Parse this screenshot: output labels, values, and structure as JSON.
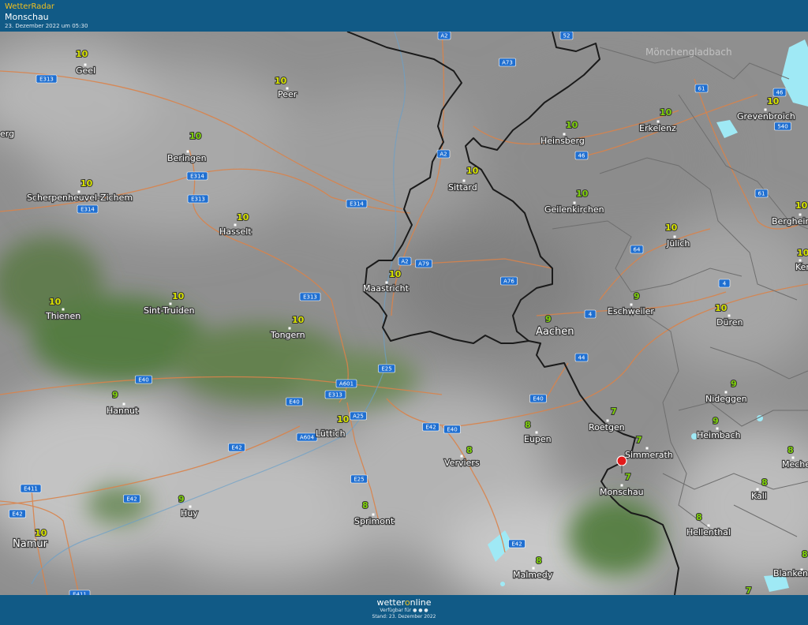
{
  "header": {
    "brand": "WetterRadar",
    "location": "Monschau",
    "timestamp": "23. Dezember 2022 um 05:30"
  },
  "places": [
    {
      "name": "Geel",
      "temp": "10"
    },
    {
      "name": "Peer",
      "temp": "10"
    },
    {
      "name": "Beringen",
      "temp": "10"
    },
    {
      "name": "Scherpenheuvel-Zichem",
      "temp": "10"
    },
    {
      "name": "Hasselt",
      "temp": "10"
    },
    {
      "name": "Thienen",
      "temp": "10"
    },
    {
      "name": "Sint-Truiden",
      "temp": "10"
    },
    {
      "name": "Tongern",
      "temp": "10"
    },
    {
      "name": "Hannut",
      "temp": "9"
    },
    {
      "name": "Lüttich",
      "temp": "10"
    },
    {
      "name": "Huy",
      "temp": "9"
    },
    {
      "name": "Namur",
      "temp": "10"
    },
    {
      "name": "Maastricht",
      "temp": "10"
    },
    {
      "name": "Sittard",
      "temp": "10"
    },
    {
      "name": "Heinsberg",
      "temp": "10"
    },
    {
      "name": "Erkelenz",
      "temp": "10"
    },
    {
      "name": "Grevenbroich",
      "temp": "10"
    },
    {
      "name": "Geilenkirchen",
      "temp": "10"
    },
    {
      "name": "Jülich",
      "temp": "10"
    },
    {
      "name": "Bergheim",
      "temp": "10"
    },
    {
      "name": "Ker",
      "temp": "10"
    },
    {
      "name": "Eschweiler",
      "temp": "9"
    },
    {
      "name": "Düren",
      "temp": "10"
    },
    {
      "name": "Aachen",
      "temp": "9"
    },
    {
      "name": "Nideggen",
      "temp": "9"
    },
    {
      "name": "Heimbach",
      "temp": "9"
    },
    {
      "name": "Roetgen",
      "temp": "7"
    },
    {
      "name": "Simmerath",
      "temp": "7"
    },
    {
      "name": "Monschau",
      "temp": "7"
    },
    {
      "name": "Eupen",
      "temp": "8"
    },
    {
      "name": "Verviers",
      "temp": "8"
    },
    {
      "name": "Sprimont",
      "temp": "8"
    },
    {
      "name": "Malmedy",
      "temp": "8"
    },
    {
      "name": "Mecher",
      "temp": "8"
    },
    {
      "name": "Kall",
      "temp": "8"
    },
    {
      "name": "Hellenthal",
      "temp": "8"
    },
    {
      "name": "Blanken",
      "temp": "8"
    },
    {
      "name": "erg",
      "temp": ""
    },
    {
      "name": "",
      "temp": "7"
    }
  ],
  "roads": [
    "A2",
    "A2",
    "A2",
    "52",
    "A73",
    "61",
    "46",
    "540",
    "46",
    "61",
    "E313",
    "E314",
    "E313",
    "E314",
    "E314",
    "E313",
    "A79",
    "A76",
    "64",
    "4",
    "4",
    "44",
    "E25",
    "A601",
    "E313",
    "E40",
    "E40",
    "A25",
    "A604",
    "E42",
    "E40",
    "E42",
    "E40",
    "E25",
    "E42",
    "E411",
    "E42",
    "E42",
    "E411"
  ],
  "map_faded": "Mönchengladbach",
  "footer": {
    "logo_a": "wetter",
    "logo_o": "o",
    "logo_b": "nline",
    "available": "Verfügbar für",
    "status": "Stand: 23. Dezember 2022"
  },
  "colors": {
    "header": "#115a86",
    "temp_green": "#7fd10a",
    "temp_yellow": "#d8e400",
    "road": "#d9834b",
    "border": "#1a1a1a",
    "water": "#9fe9f5"
  }
}
